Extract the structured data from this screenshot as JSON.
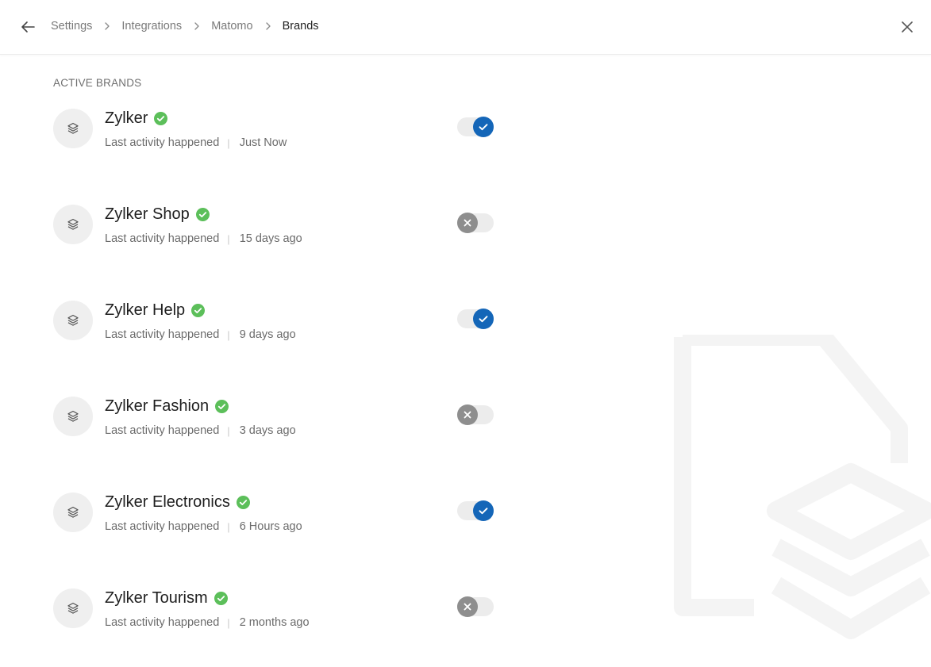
{
  "breadcrumb": [
    "Settings",
    "Integrations",
    "Matomo",
    "Brands"
  ],
  "section_title": "ACTIVE BRANDS",
  "brands": [
    {
      "name": "Zylker",
      "meta_label": "Last activity happened",
      "last_activity": "Just Now",
      "enabled": true
    },
    {
      "name": "Zylker Shop",
      "meta_label": "Last activity happened",
      "last_activity": "15 days ago",
      "enabled": false
    },
    {
      "name": "Zylker Help",
      "meta_label": "Last activity happened",
      "last_activity": "9 days ago",
      "enabled": true
    },
    {
      "name": "Zylker Fashion",
      "meta_label": "Last activity happened",
      "last_activity": "3 days ago",
      "enabled": false
    },
    {
      "name": "Zylker Electronics",
      "meta_label": "Last activity happened",
      "last_activity": "6 Hours ago",
      "enabled": true
    },
    {
      "name": "Zylker Tourism",
      "meta_label": "Last activity happened",
      "last_activity": "2 months ago",
      "enabled": false
    }
  ],
  "icons": {
    "back": "arrow-left-icon",
    "close": "close-icon",
    "separator": "chevron-right-icon",
    "brand": "layers-icon",
    "verified": "check-circle-icon",
    "watermark": "document-layers-illustration"
  },
  "colors": {
    "toggle_on": "#1466b8",
    "toggle_off": "#8e8e8e",
    "verified": "#5cbf5a"
  }
}
